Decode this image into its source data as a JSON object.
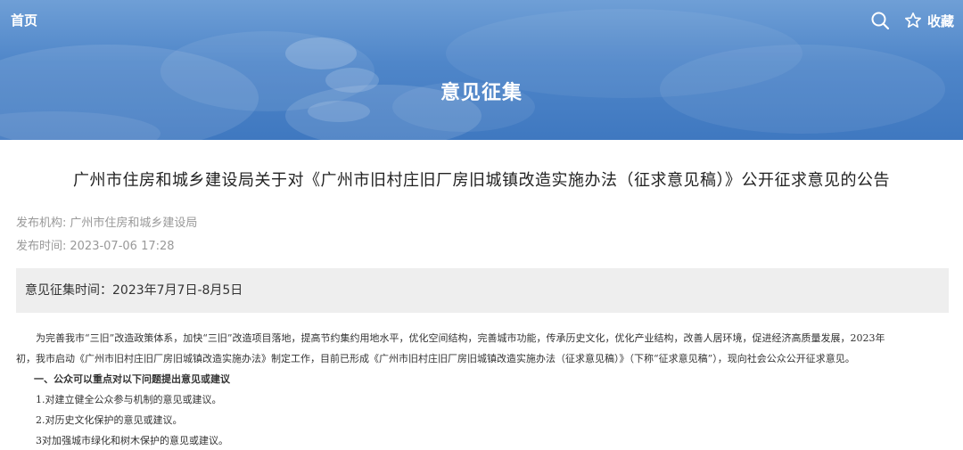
{
  "header": {
    "home_label": "首页",
    "favorite_label": "收藏",
    "search_icon": "search-icon",
    "favorite_icon": "star-outline-icon",
    "banner_title": "意见征集",
    "banner_color": "#4f86c9"
  },
  "article": {
    "title": "广州市住房和城乡建设局关于对《广州市旧村庄旧厂房旧城镇改造实施办法（征求意见稿）》公开征求意见的公告",
    "publisher_key": "发布机构:",
    "publisher_value": "广州市住房和城乡建设局",
    "time_key": "发布时间:",
    "time_value": "2023-07-06 17:28",
    "deadline": "意见征集时间：2023年7月7日-8月5日",
    "intro_line1": "为完善我市“三旧”改造政策体系，加快“三旧”改造项目落地，提高节约集约用地水平，优化空间结构，完善城市功能，传承历史文化，优化产业结构，改善人居环境，促进经济高质量发展，2023年",
    "intro_line2": "初，我市启动《广州市旧村庄旧厂房旧城镇改造实施办法》制定工作，目前已形成《广州市旧村庄旧厂房旧城镇改造实施办法（征求意见稿）》（下称“征求意见稿”），现向社会公众公开征求意见。",
    "section1": "一、公众可以重点对以下问题提出意见或建议",
    "items": [
      "1.对建立健全公众参与机制的意见或建议。",
      "2.对历史文化保护的意见或建议。",
      "3对加强城市绿化和树木保护的意见或建议。"
    ]
  }
}
